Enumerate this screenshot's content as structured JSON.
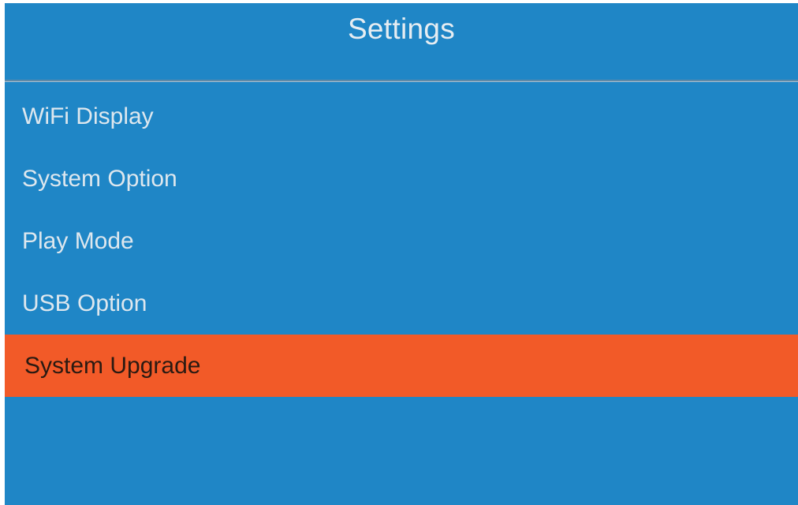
{
  "header": {
    "title": "Settings"
  },
  "menu": {
    "items": [
      {
        "label": "WiFi Display",
        "selected": false
      },
      {
        "label": "System Option",
        "selected": false
      },
      {
        "label": "Play Mode",
        "selected": false
      },
      {
        "label": "USB Option",
        "selected": false
      },
      {
        "label": "System Upgrade",
        "selected": true
      }
    ]
  },
  "colors": {
    "background": "#1f86c6",
    "highlight": "#f25a28",
    "text": "#dde7ee"
  }
}
